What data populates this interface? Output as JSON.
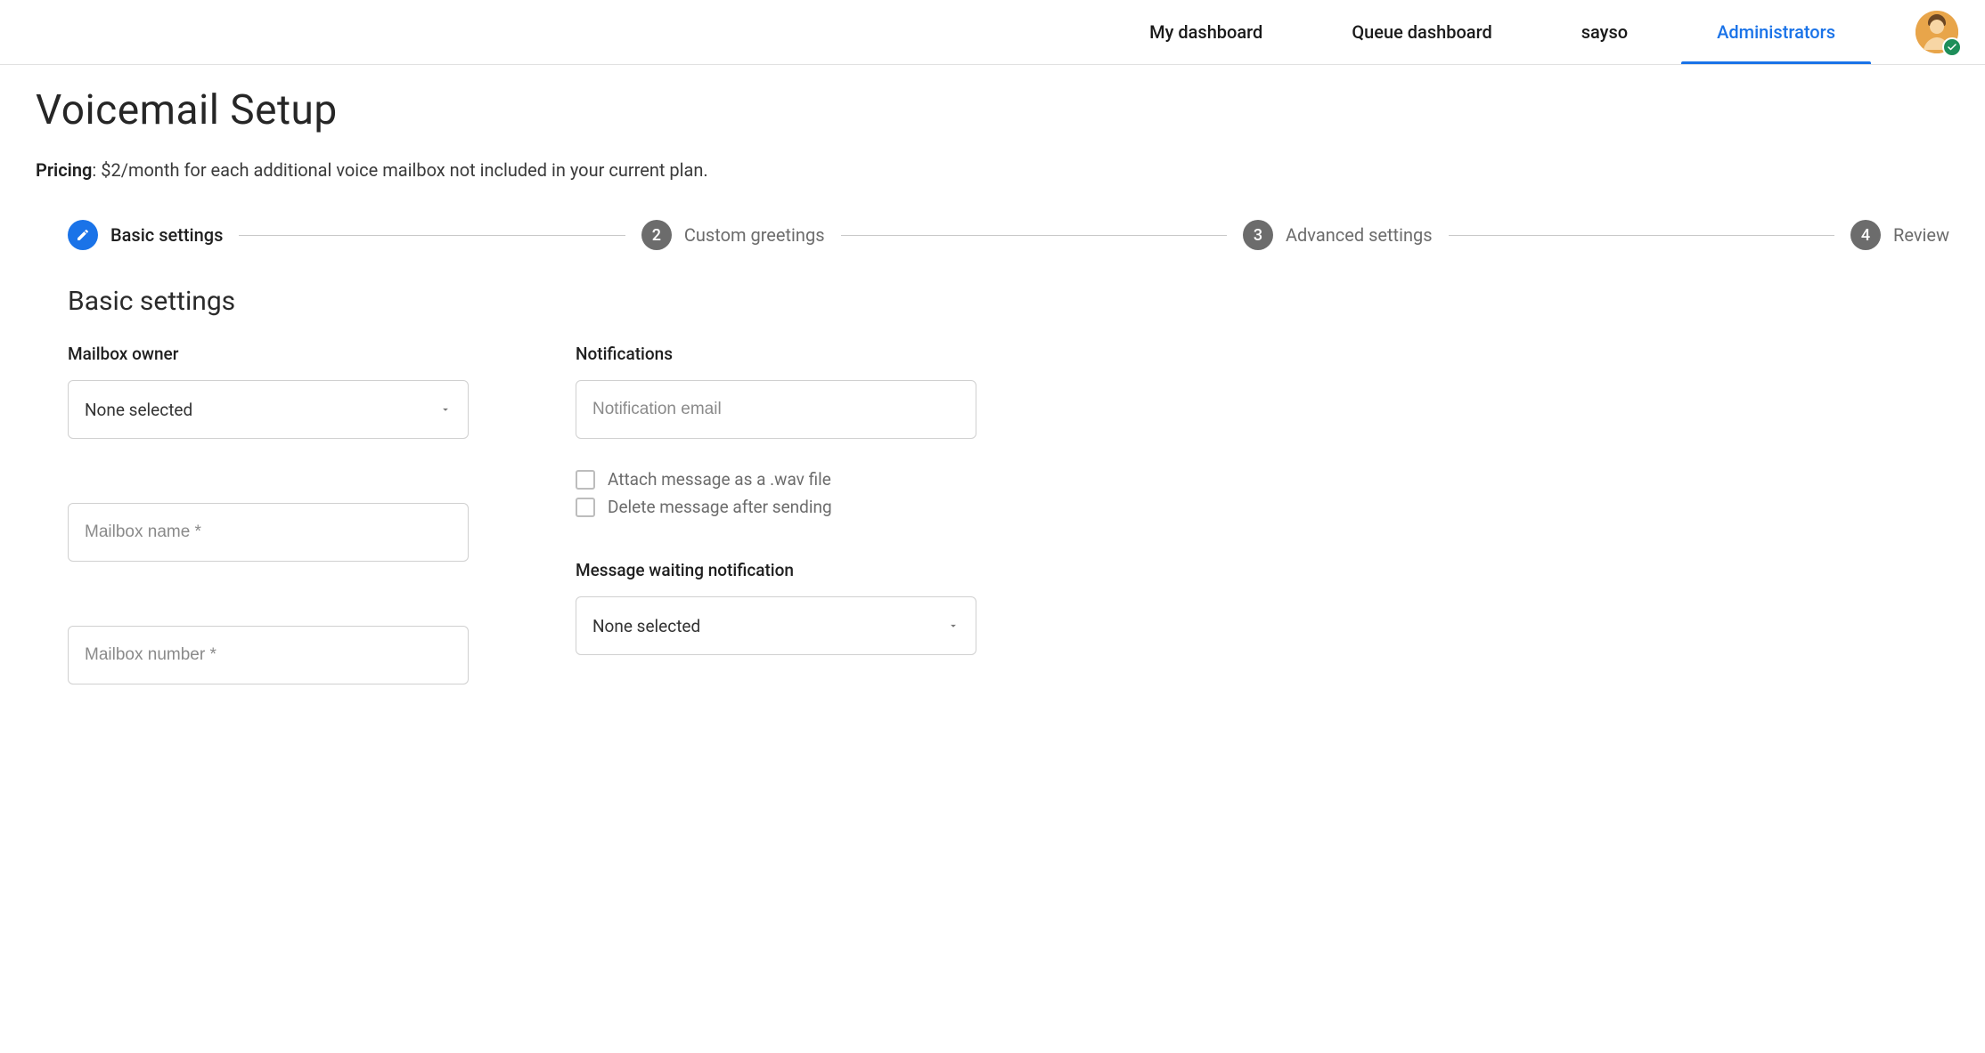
{
  "header": {
    "tabs": [
      {
        "label": "My dashboard",
        "active": false
      },
      {
        "label": "Queue dashboard",
        "active": false
      },
      {
        "label": "sayso",
        "active": false
      },
      {
        "label": "Administrators",
        "active": true
      }
    ]
  },
  "page": {
    "title": "Voicemail Setup",
    "pricing_label": "Pricing",
    "pricing_text": ": $2/month for each additional voice mailbox not included in your current plan."
  },
  "stepper": {
    "steps": [
      {
        "num": "1",
        "label": "Basic settings",
        "active": true,
        "icon": "pencil"
      },
      {
        "num": "2",
        "label": "Custom greetings",
        "active": false
      },
      {
        "num": "3",
        "label": "Advanced settings",
        "active": false
      },
      {
        "num": "4",
        "label": "Review",
        "active": false
      }
    ]
  },
  "section": {
    "heading": "Basic settings"
  },
  "left": {
    "mailbox_owner_label": "Mailbox owner",
    "mailbox_owner_value": "None selected",
    "mailbox_name_placeholder": "Mailbox name *",
    "mailbox_number_placeholder": "Mailbox number *"
  },
  "right": {
    "notifications_label": "Notifications",
    "notification_email_placeholder": "Notification email",
    "attach_wav_label": "Attach message as a .wav file",
    "delete_after_label": "Delete message after sending",
    "mwi_label": "Message waiting notification",
    "mwi_value": "None selected"
  }
}
